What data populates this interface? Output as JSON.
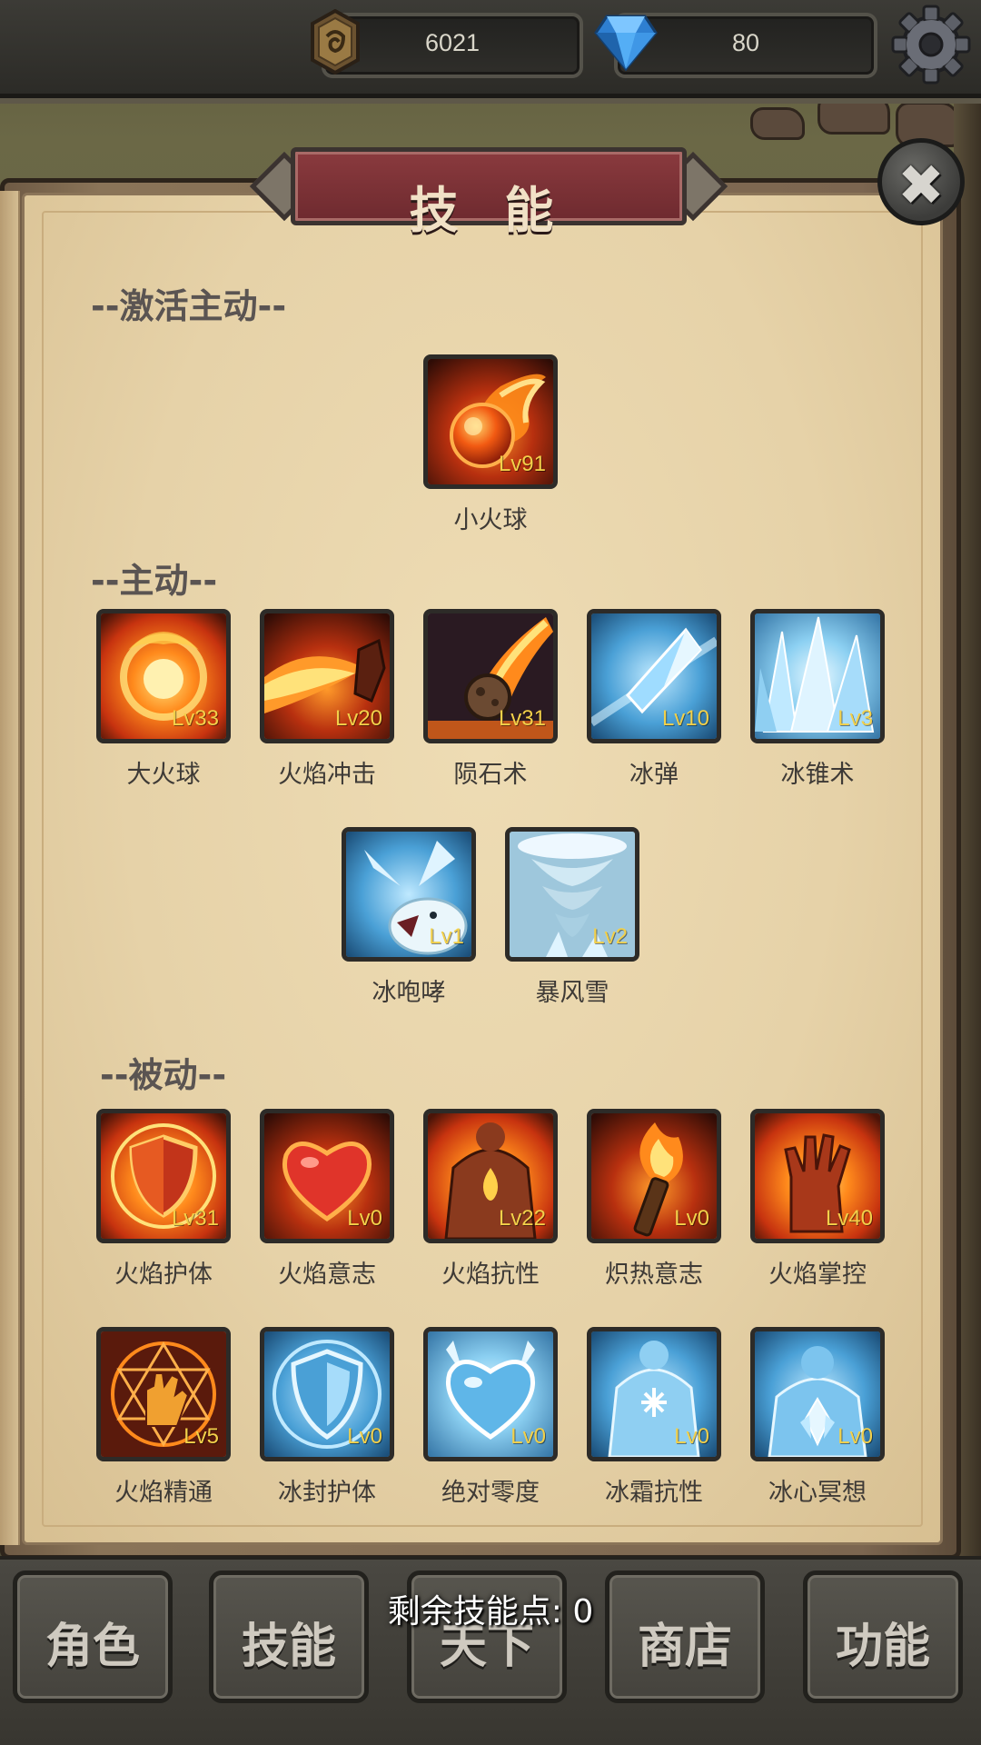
{
  "resources": {
    "coins": "6021",
    "gems": "80"
  },
  "panel": {
    "title": "技 能"
  },
  "sections": {
    "activated": "--激活主动--",
    "active": "--主动--",
    "passive": "--被动--"
  },
  "activated_skills": [
    {
      "name": "小火球",
      "level": "Lv91",
      "icon": "fireball-icon"
    }
  ],
  "active_skills": [
    {
      "name": "大火球",
      "level": "Lv33",
      "icon": "big-fireball-icon"
    },
    {
      "name": "火焰冲击",
      "level": "Lv20",
      "icon": "flame-blast-icon"
    },
    {
      "name": "陨石术",
      "level": "Lv31",
      "icon": "meteor-icon"
    },
    {
      "name": "冰弹",
      "level": "Lv10",
      "icon": "ice-bolt-icon"
    },
    {
      "name": "冰锥术",
      "level": "Lv3",
      "icon": "ice-spikes-icon"
    },
    {
      "name": "冰咆哮",
      "level": "Lv1",
      "icon": "ice-bear-roar-icon"
    },
    {
      "name": "暴风雪",
      "level": "Lv2",
      "icon": "blizzard-icon"
    }
  ],
  "passive_skills": [
    {
      "name": "火焰护体",
      "level": "Lv31",
      "icon": "flame-shield-icon"
    },
    {
      "name": "火焰意志",
      "level": "Lv0",
      "icon": "flame-heart-icon"
    },
    {
      "name": "火焰抗性",
      "level": "Lv22",
      "icon": "flame-body-icon"
    },
    {
      "name": "炽热意志",
      "level": "Lv0",
      "icon": "torch-icon"
    },
    {
      "name": "火焰掌控",
      "level": "Lv40",
      "icon": "flame-hand-icon"
    },
    {
      "name": "火焰精通",
      "level": "Lv5",
      "icon": "flame-sigil-icon"
    },
    {
      "name": "冰封护体",
      "level": "Lv0",
      "icon": "ice-shield-icon"
    },
    {
      "name": "绝对零度",
      "level": "Lv0",
      "icon": "ice-heart-icon"
    },
    {
      "name": "冰霜抗性",
      "level": "Lv0",
      "icon": "ice-body-icon"
    },
    {
      "name": "冰心冥想",
      "level": "Lv0",
      "icon": "ice-meditation-icon"
    }
  ],
  "skill_points": {
    "text": "剩余技能点:  0"
  },
  "nav": [
    {
      "label": "角色",
      "icon": ""
    },
    {
      "label": "技能",
      "icon": ""
    },
    {
      "label": "天下",
      "icon": ""
    },
    {
      "label": "商店",
      "icon": ""
    },
    {
      "label": "功能",
      "icon": ""
    }
  ],
  "colors": {
    "fire": "#e8541a",
    "ice": "#5fb6e8",
    "level_text": "#f2d04a",
    "title_plate": "#7a3136"
  }
}
